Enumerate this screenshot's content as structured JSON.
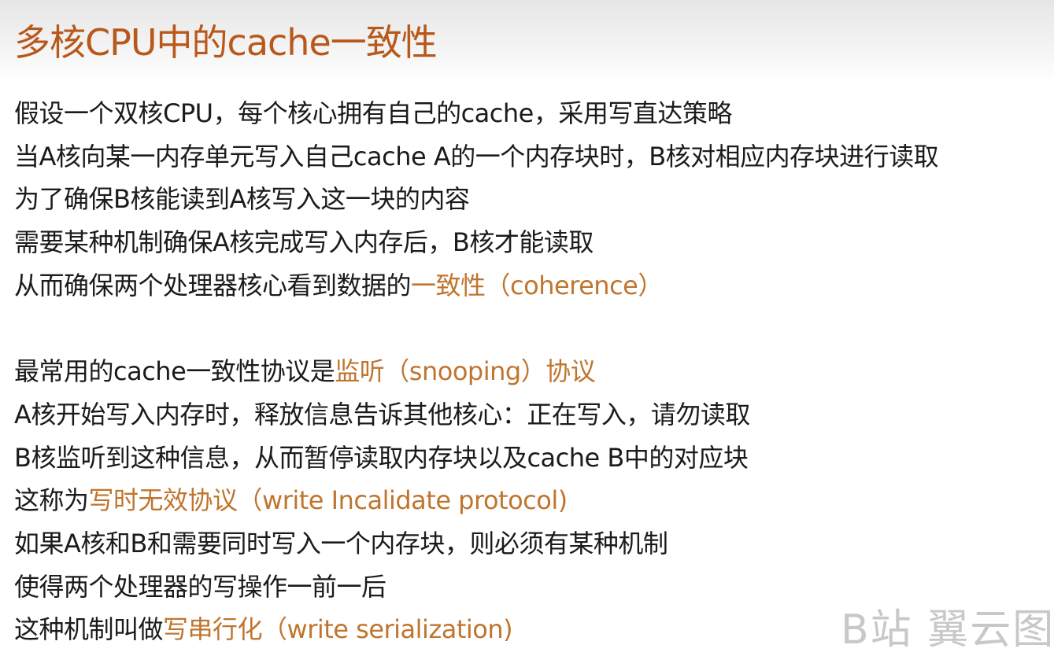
{
  "title": "多核CPU中的cache一致性",
  "paragraph1": [
    {
      "text": "假设一个双核CPU，每个核心拥有自己的cache，采用写直达策略",
      "hl": "",
      "tail": ""
    },
    {
      "text": "当A核向某一内存单元写入自己cache A的一个内存块时，B核对相应内存块进行读取",
      "hl": "",
      "tail": ""
    },
    {
      "text": "为了确保B核能读到A核写入这一块的内容",
      "hl": "",
      "tail": ""
    },
    {
      "text": "需要某种机制确保A核完成写入内存后，B核才能读取",
      "hl": "",
      "tail": ""
    },
    {
      "text": "从而确保两个处理器核心看到数据的",
      "hl": "一致性（coherence）",
      "tail": ""
    }
  ],
  "paragraph2": [
    {
      "text": "最常用的cache一致性协议是",
      "hl": "监听（snooping）协议",
      "tail": ""
    },
    {
      "text": "A核开始写入内存时，释放信息告诉其他核心：正在写入，请勿读取",
      "hl": "",
      "tail": ""
    },
    {
      "text": "B核监听到这种信息，从而暂停读取内存块以及cache B中的对应块",
      "hl": "",
      "tail": ""
    },
    {
      "text": "这称为",
      "hl": "写时无效协议（write Incalidate protocol)",
      "tail": ""
    },
    {
      "text": "如果A核和B和需要同时写入一个内存块，则必须有某种机制",
      "hl": "",
      "tail": ""
    },
    {
      "text": "使得两个处理器的写操作一前一后",
      "hl": "",
      "tail": ""
    },
    {
      "text": "这种机制叫做",
      "hl": "写串行化（write serialization)",
      "tail": ""
    }
  ],
  "watermark": "B站 翼云图",
  "colors": {
    "title": "#b8581a",
    "highlight": "#c0752e",
    "body_text": "#1b1b1b",
    "watermark": "#c8c8c8"
  }
}
